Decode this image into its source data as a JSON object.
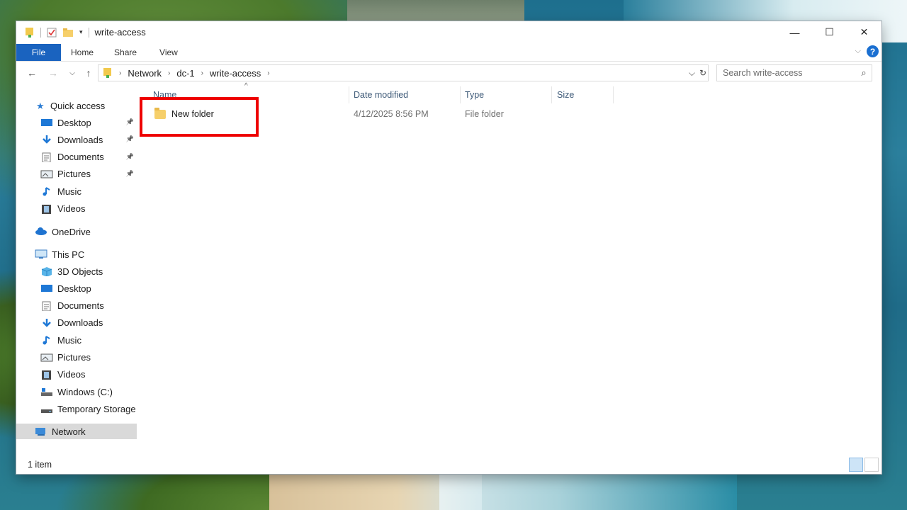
{
  "window": {
    "title": "write-access",
    "controls": [
      "—",
      "☐",
      "✕"
    ]
  },
  "ribbon": {
    "tabs": [
      "File",
      "Home",
      "Share",
      "View"
    ],
    "help_label": "?"
  },
  "navigation": {
    "breadcrumb": [
      "Network",
      "dc-1",
      "write-access"
    ],
    "search_placeholder": "Search write-access"
  },
  "sidebar": {
    "quick_access": "Quick access",
    "quick_items": [
      {
        "label": "Desktop",
        "icon": "desktop-icon",
        "pinned": true
      },
      {
        "label": "Downloads",
        "icon": "downloads-icon",
        "pinned": true
      },
      {
        "label": "Documents",
        "icon": "documents-icon",
        "pinned": true
      },
      {
        "label": "Pictures",
        "icon": "pictures-icon",
        "pinned": true
      },
      {
        "label": "Music",
        "icon": "music-icon",
        "pinned": false
      },
      {
        "label": "Videos",
        "icon": "videos-icon",
        "pinned": false
      }
    ],
    "onedrive": "OneDrive",
    "this_pc": "This PC",
    "pc_items": [
      {
        "label": "3D Objects",
        "icon": "3d-objects-icon"
      },
      {
        "label": "Desktop",
        "icon": "desktop-icon"
      },
      {
        "label": "Documents",
        "icon": "documents-icon"
      },
      {
        "label": "Downloads",
        "icon": "downloads-icon"
      },
      {
        "label": "Music",
        "icon": "music-icon"
      },
      {
        "label": "Pictures",
        "icon": "pictures-icon"
      },
      {
        "label": "Videos",
        "icon": "videos-icon"
      },
      {
        "label": "Windows (C:)",
        "icon": "drive-c-icon"
      },
      {
        "label": "Temporary Storage",
        "icon": "drive-icon"
      }
    ],
    "network": "Network"
  },
  "files": {
    "columns": [
      "Name",
      "Date modified",
      "Type",
      "Size"
    ],
    "rows": [
      {
        "name": "New folder",
        "date": "4/12/2025 8:56 PM",
        "type": "File folder",
        "size": ""
      }
    ]
  },
  "status": {
    "count": "1 item"
  },
  "colors": {
    "file_tab": "#1a63bf",
    "highlight_box": "#ee0000",
    "selected_nav": "#d9d9d9"
  }
}
